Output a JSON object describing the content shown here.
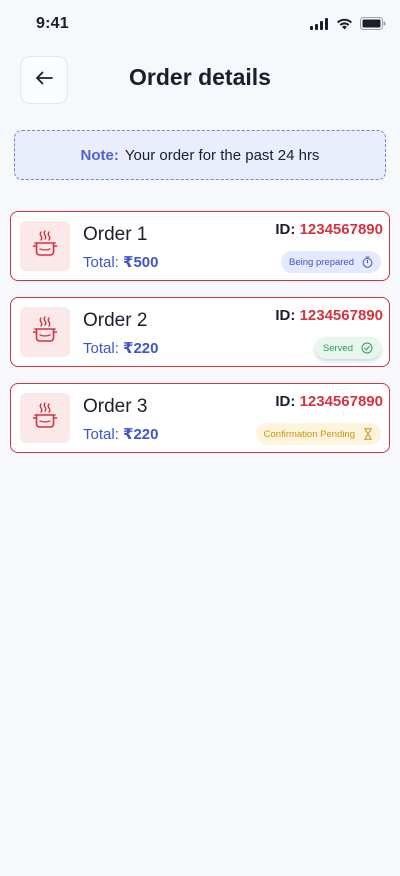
{
  "status_bar": {
    "time": "9:41"
  },
  "header": {
    "title": "Order details"
  },
  "note": {
    "label": "Note:",
    "text": "Your order for the past 24 hrs"
  },
  "orders": [
    {
      "title": "Order 1",
      "total_label": "Total:",
      "total_value": "₹500",
      "id_label": "ID:",
      "id_value": "1234567890",
      "status": "Being prepared"
    },
    {
      "title": "Order 2",
      "total_label": "Total:",
      "total_value": "₹220",
      "id_label": "ID:",
      "id_value": "1234567890",
      "status": "Served"
    },
    {
      "title": "Order 3",
      "total_label": "Total:",
      "total_value": "₹220",
      "id_label": "ID:",
      "id_value": "1234567890",
      "status": "Confirmation Pending"
    }
  ],
  "colors": {
    "accent_red": "#d3343f",
    "accent_blue": "#3f55c7",
    "served_green": "#2f9a57",
    "pending_amber": "#c99416"
  },
  "icons": {
    "back": "arrow-left-icon",
    "order": "cooking-pot-icon",
    "prepared": "timer-icon",
    "served": "check-circle-icon",
    "pending": "hourglass-icon"
  }
}
